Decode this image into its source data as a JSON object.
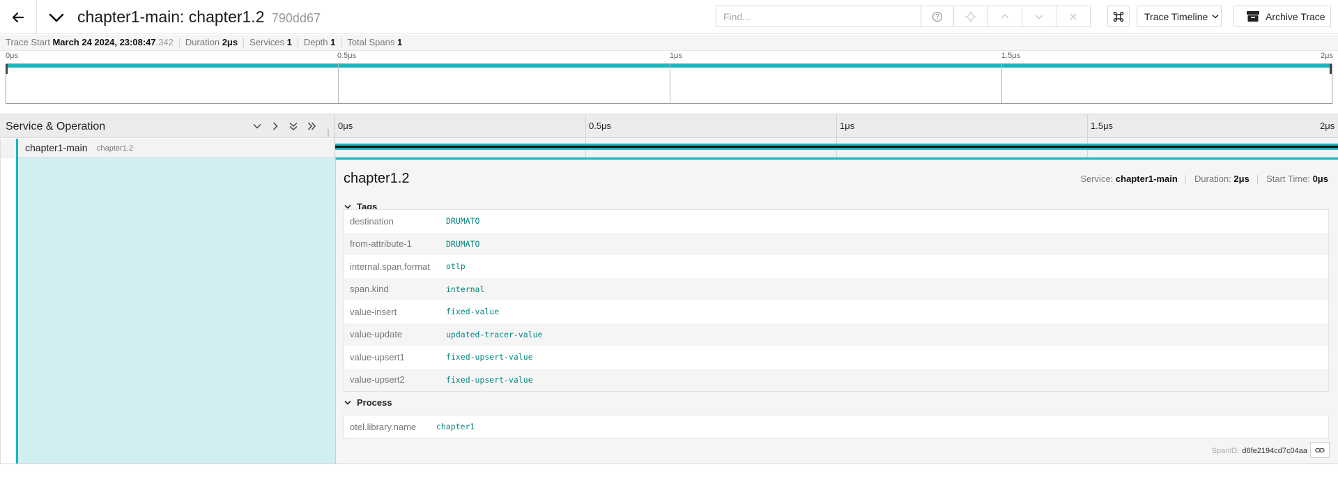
{
  "header": {
    "title": "chapter1-main: chapter1.2",
    "trace_id": "790dd67",
    "find_placeholder": "Find...",
    "view_label": "Trace Timeline",
    "archive_label": "Archive Trace",
    "icons": [
      "arrow-left-icon",
      "chevron-down-icon",
      "help-icon",
      "locate-icon",
      "chevron-up-icon",
      "chevron-down-icon",
      "close-icon",
      "command-icon",
      "archive-icon"
    ]
  },
  "stats": {
    "trace_start_label": "Trace Start",
    "trace_start_value": "March 24 2024, 23:08:47",
    "trace_start_ms": ".342",
    "duration_label": "Duration",
    "duration_value": "2μs",
    "services_label": "Services",
    "services_value": "1",
    "depth_label": "Depth",
    "depth_value": "1",
    "total_spans_label": "Total Spans",
    "total_spans_value": "1"
  },
  "minimap": {
    "ticks": [
      "0μs",
      "0.5μs",
      "1μs",
      "1.5μs",
      "2μs"
    ]
  },
  "timeline_header": {
    "title": "Service & Operation",
    "ticks": [
      "0μs",
      "0.5μs",
      "1μs",
      "1.5μs",
      "2μs"
    ]
  },
  "span": {
    "service": "chapter1-main",
    "operation": "chapter1.2"
  },
  "detail": {
    "title": "chapter1.2",
    "service_label": "Service:",
    "service_value": "chapter1-main",
    "duration_label": "Duration:",
    "duration_value": "2μs",
    "start_label": "Start Time:",
    "start_value": "0μs",
    "tags_label": "Tags",
    "tags": [
      {
        "key": "destination",
        "value": "DRUMATO"
      },
      {
        "key": "from-attribute-1",
        "value": "DRUMATO"
      },
      {
        "key": "internal.span.format",
        "value": "otlp"
      },
      {
        "key": "span.kind",
        "value": "internal"
      },
      {
        "key": "value-insert",
        "value": "fixed-value"
      },
      {
        "key": "value-update",
        "value": "updated-tracer-value"
      },
      {
        "key": "value-upsert1",
        "value": "fixed-upsert-value"
      },
      {
        "key": "value-upsert2",
        "value": "fixed-upsert-value"
      }
    ],
    "process_label": "Process",
    "process": [
      {
        "key": "otel.library.name",
        "value": "chapter1"
      }
    ],
    "span_id_label": "SpanID:",
    "span_id_value": "d6fe2194cd7c04aa"
  },
  "colors": {
    "accent": "#17b8be",
    "row_selected": "#d1eff0",
    "tag_value": "#00867f"
  }
}
